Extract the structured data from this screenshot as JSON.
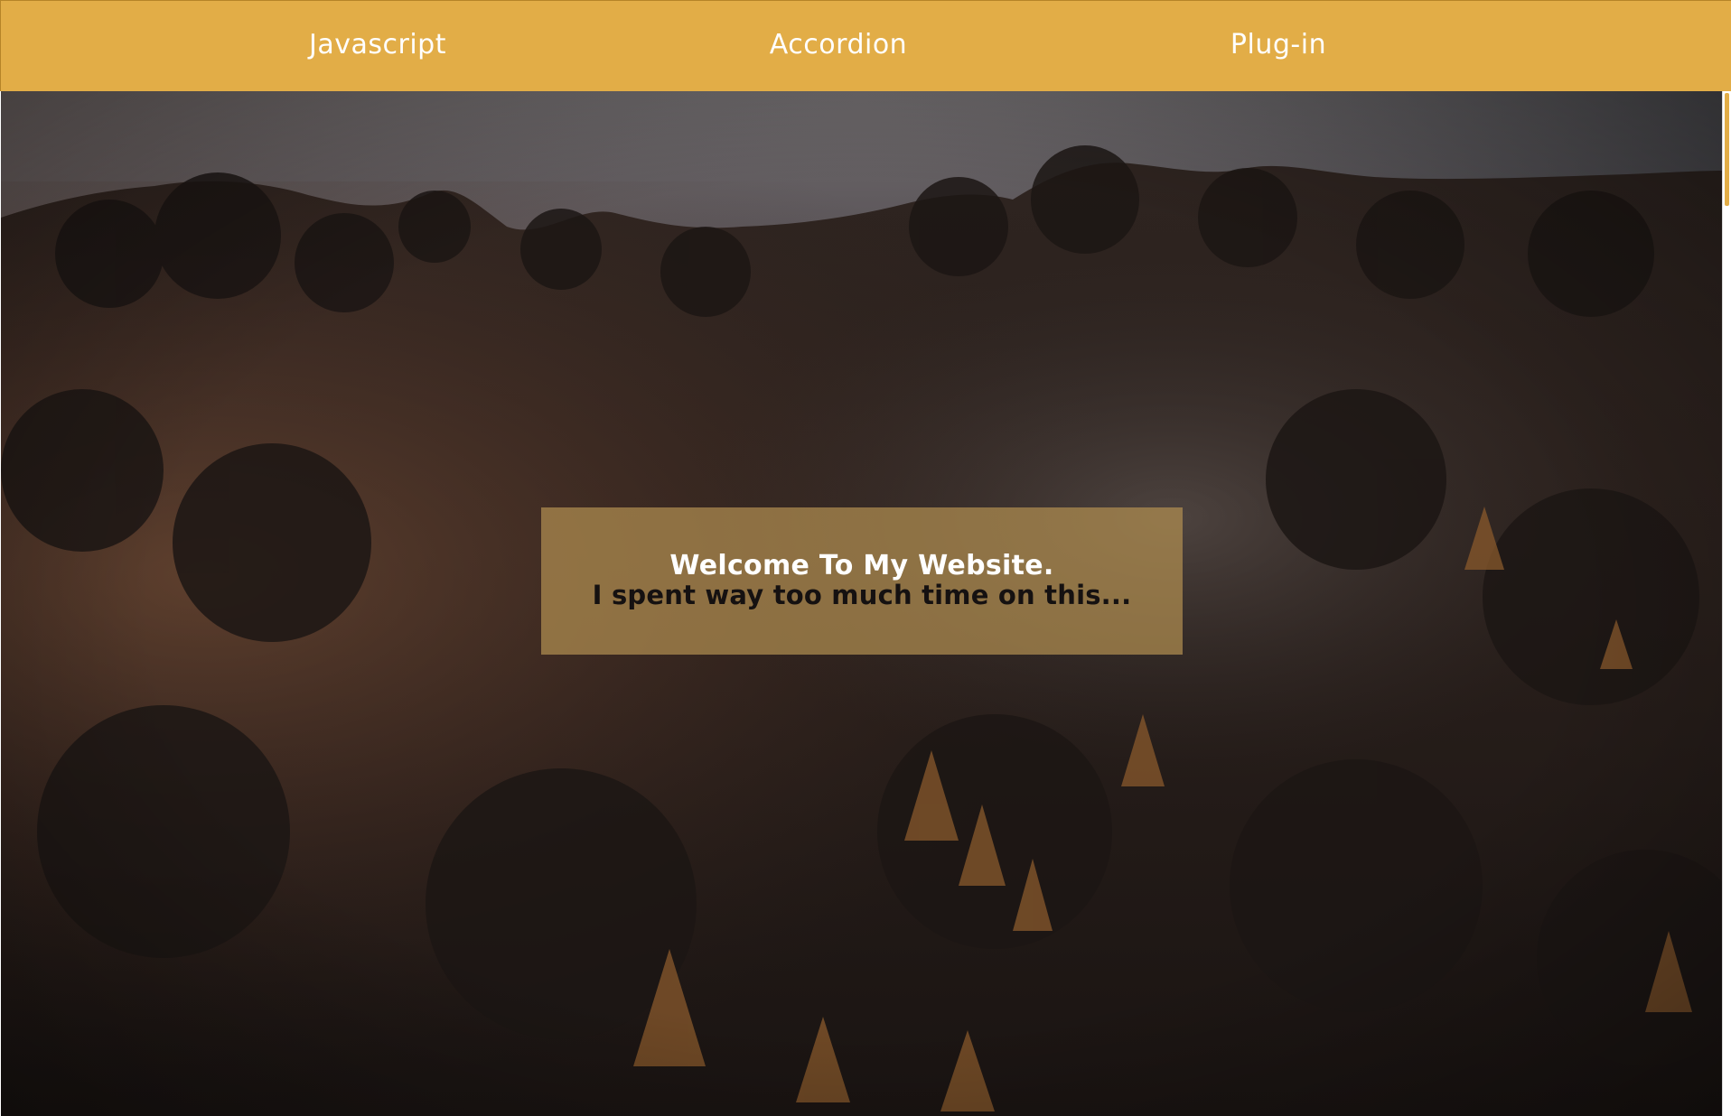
{
  "nav": {
    "items": [
      {
        "label": "Javascript"
      },
      {
        "label": "Accordion"
      },
      {
        "label": "Plug-in"
      }
    ]
  },
  "hero": {
    "background_image": "forest-hillside-autumn-aerial",
    "welcome_title": "Welcome To My Website.",
    "welcome_subtitle": "I spent way too much time on this..."
  },
  "colors": {
    "nav_bar": "#e2ad47",
    "nav_text": "#ffffff",
    "welcome_panel": "#b08d50",
    "welcome_title": "#ffffff",
    "welcome_subtitle": "#151111"
  }
}
